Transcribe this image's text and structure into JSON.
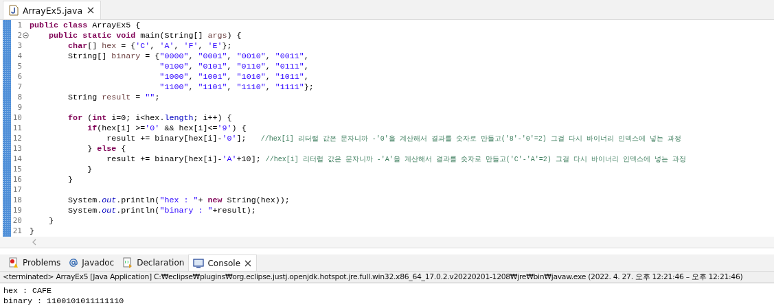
{
  "editor_tab": {
    "label": "ArrayEx5.java",
    "selected": true
  },
  "code_lines": [
    {
      "number": "1",
      "fold": false,
      "tokens": [
        {
          "kind": "kw",
          "text": "public class"
        },
        {
          "kind": "plain",
          "text": " ArrayEx5 {"
        }
      ]
    },
    {
      "number": "2",
      "fold": true,
      "tokens": [
        {
          "kind": "kw",
          "text": "    public static void"
        },
        {
          "kind": "plain",
          "text": " main(String[] "
        },
        {
          "kind": "var",
          "text": "args"
        },
        {
          "kind": "plain",
          "text": ") {"
        }
      ]
    },
    {
      "number": "3",
      "fold": false,
      "tokens": [
        {
          "kind": "kw",
          "text": "        char"
        },
        {
          "kind": "plain",
          "text": "[] "
        },
        {
          "kind": "var",
          "text": "hex"
        },
        {
          "kind": "plain",
          "text": " = {"
        },
        {
          "kind": "str",
          "text": "'C'"
        },
        {
          "kind": "plain",
          "text": ", "
        },
        {
          "kind": "str",
          "text": "'A'"
        },
        {
          "kind": "plain",
          "text": ", "
        },
        {
          "kind": "str",
          "text": "'F'"
        },
        {
          "kind": "plain",
          "text": ", "
        },
        {
          "kind": "str",
          "text": "'E'"
        },
        {
          "kind": "plain",
          "text": "};"
        }
      ]
    },
    {
      "number": "4",
      "fold": false,
      "tokens": [
        {
          "kind": "plain",
          "text": "        String[] "
        },
        {
          "kind": "var",
          "text": "binary"
        },
        {
          "kind": "plain",
          "text": " = {"
        },
        {
          "kind": "str",
          "text": "\"0000\""
        },
        {
          "kind": "plain",
          "text": ", "
        },
        {
          "kind": "str",
          "text": "\"0001\""
        },
        {
          "kind": "plain",
          "text": ", "
        },
        {
          "kind": "str",
          "text": "\"0010\""
        },
        {
          "kind": "plain",
          "text": ", "
        },
        {
          "kind": "str",
          "text": "\"0011\""
        },
        {
          "kind": "plain",
          "text": ","
        }
      ]
    },
    {
      "number": "5",
      "fold": false,
      "tokens": [
        {
          "kind": "str",
          "text": "                           \"0100\""
        },
        {
          "kind": "plain",
          "text": ", "
        },
        {
          "kind": "str",
          "text": "\"0101\""
        },
        {
          "kind": "plain",
          "text": ", "
        },
        {
          "kind": "str",
          "text": "\"0110\""
        },
        {
          "kind": "plain",
          "text": ", "
        },
        {
          "kind": "str",
          "text": "\"0111\""
        },
        {
          "kind": "plain",
          "text": ","
        }
      ]
    },
    {
      "number": "6",
      "fold": false,
      "tokens": [
        {
          "kind": "str",
          "text": "                           \"1000\""
        },
        {
          "kind": "plain",
          "text": ", "
        },
        {
          "kind": "str",
          "text": "\"1001\""
        },
        {
          "kind": "plain",
          "text": ", "
        },
        {
          "kind": "str",
          "text": "\"1010\""
        },
        {
          "kind": "plain",
          "text": ", "
        },
        {
          "kind": "str",
          "text": "\"1011\""
        },
        {
          "kind": "plain",
          "text": ","
        }
      ]
    },
    {
      "number": "7",
      "fold": false,
      "tokens": [
        {
          "kind": "str",
          "text": "                           \"1100\""
        },
        {
          "kind": "plain",
          "text": ", "
        },
        {
          "kind": "str",
          "text": "\"1101\""
        },
        {
          "kind": "plain",
          "text": ", "
        },
        {
          "kind": "str",
          "text": "\"1110\""
        },
        {
          "kind": "plain",
          "text": ", "
        },
        {
          "kind": "str",
          "text": "\"1111\""
        },
        {
          "kind": "plain",
          "text": "};"
        }
      ]
    },
    {
      "number": "8",
      "fold": false,
      "tokens": [
        {
          "kind": "plain",
          "text": "        String "
        },
        {
          "kind": "var",
          "text": "result"
        },
        {
          "kind": "plain",
          "text": " = "
        },
        {
          "kind": "str",
          "text": "\"\""
        },
        {
          "kind": "plain",
          "text": ";"
        }
      ]
    },
    {
      "number": "9",
      "fold": false
    },
    {
      "number": "10",
      "fold": false,
      "tokens": [
        {
          "kind": "kw",
          "text": "        for"
        },
        {
          "kind": "plain",
          "text": " ("
        },
        {
          "kind": "kw",
          "text": "int"
        },
        {
          "kind": "plain",
          "text": " i=0; i<hex."
        },
        {
          "kind": "field",
          "text": "length"
        },
        {
          "kind": "plain",
          "text": "; i++) {"
        }
      ]
    },
    {
      "number": "11",
      "fold": false,
      "tokens": [
        {
          "kind": "kw",
          "text": "            if"
        },
        {
          "kind": "plain",
          "text": "(hex[i] >="
        },
        {
          "kind": "str",
          "text": "'0'"
        },
        {
          "kind": "plain",
          "text": " && hex[i]<="
        },
        {
          "kind": "str",
          "text": "'9'"
        },
        {
          "kind": "plain",
          "text": ") {"
        }
      ]
    },
    {
      "number": "12",
      "fold": false,
      "tokens": [
        {
          "kind": "plain",
          "text": "                result += binary[hex[i]-"
        },
        {
          "kind": "str",
          "text": "'0'"
        },
        {
          "kind": "plain",
          "text": "];   "
        },
        {
          "kind": "comment",
          "text": "//hex[i] 리터럴 값은 문자니까 -'0'을 계산해서 결과를 숫자로 만들고('8'-'0'=2) 그걸 다시 바이너리 인덱스에 넣는 과정"
        }
      ]
    },
    {
      "number": "13",
      "fold": false,
      "tokens": [
        {
          "kind": "plain",
          "text": "            } "
        },
        {
          "kind": "kw",
          "text": "else"
        },
        {
          "kind": "plain",
          "text": " {"
        }
      ]
    },
    {
      "number": "14",
      "fold": false,
      "tokens": [
        {
          "kind": "plain",
          "text": "                result += binary[hex[i]-"
        },
        {
          "kind": "str",
          "text": "'A'"
        },
        {
          "kind": "plain",
          "text": "+10]; "
        },
        {
          "kind": "comment",
          "text": "//hex[i] 리터럴 값은 문자니까 -'A'을 계산해서 결과를 숫자로 만들고('C'-'A'=2) 그걸 다시 바이너리 인덱스에 넣는 과정"
        }
      ]
    },
    {
      "number": "15",
      "fold": false,
      "tokens": [
        {
          "kind": "plain",
          "text": "            }"
        }
      ]
    },
    {
      "number": "16",
      "fold": false,
      "tokens": [
        {
          "kind": "plain",
          "text": "        }"
        }
      ]
    },
    {
      "number": "17",
      "fold": false
    },
    {
      "number": "18",
      "fold": false,
      "tokens": [
        {
          "kind": "plain",
          "text": "        System."
        },
        {
          "kind": "static",
          "text": "out"
        },
        {
          "kind": "plain",
          "text": ".println("
        },
        {
          "kind": "str",
          "text": "\"hex : \""
        },
        {
          "kind": "plain",
          "text": "+ "
        },
        {
          "kind": "kw",
          "text": "new"
        },
        {
          "kind": "plain",
          "text": " String(hex));"
        }
      ]
    },
    {
      "number": "19",
      "fold": false,
      "tokens": [
        {
          "kind": "plain",
          "text": "        System."
        },
        {
          "kind": "static",
          "text": "out"
        },
        {
          "kind": "plain",
          "text": ".println("
        },
        {
          "kind": "str",
          "text": "\"binary : \""
        },
        {
          "kind": "plain",
          "text": "+result);"
        }
      ]
    },
    {
      "number": "20",
      "fold": false,
      "tokens": [
        {
          "kind": "plain",
          "text": "    }"
        }
      ]
    },
    {
      "number": "21",
      "fold": false,
      "tokens": [
        {
          "kind": "plain",
          "text": "}"
        }
      ]
    }
  ],
  "view_tabs": [
    {
      "label": "Problems",
      "selected": false
    },
    {
      "label": "Javadoc",
      "selected": false
    },
    {
      "label": "Declaration",
      "selected": false
    },
    {
      "label": "Console",
      "selected": true
    }
  ],
  "console_status": "<terminated> ArrayEx5 [Java Application] C:₩eclipse₩plugins₩org.eclipse.justj.openjdk.hotspot.jre.full.win32.x86_64_17.0.2.v20220201-1208₩jre₩bin₩javaw.exe  (2022. 4. 27. 오후 12:21:46 – 오후 12:21:46)",
  "console_output": [
    "hex : CAFE",
    "binary : 1100101011111110"
  ]
}
